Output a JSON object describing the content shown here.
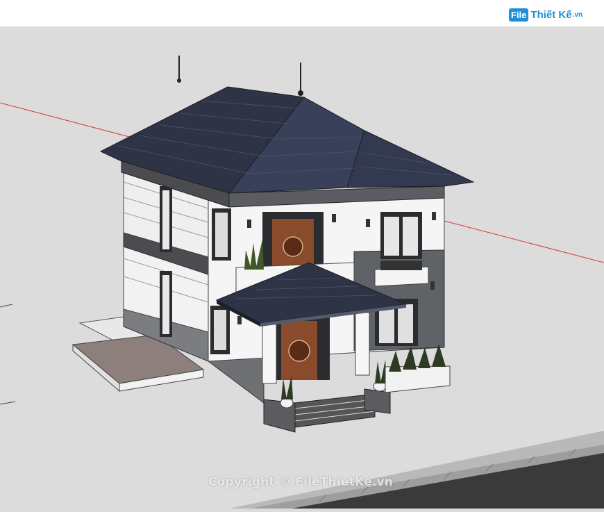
{
  "logo": {
    "box_text": "File",
    "brand_text": "Thiết Kế",
    "suffix_text": ".vn"
  },
  "watermark": {
    "text": "Copyright © FileThietKe.vn"
  },
  "colors": {
    "background": "#dcdcdc",
    "roof": "#2e3445",
    "wall": "#eeeeee",
    "door": "#8a4a2c",
    "axis_red": "#d43a3a",
    "brand": "#1f8fd6"
  },
  "icons": [
    "axis-marker-icon",
    "roof-finial-icon"
  ]
}
